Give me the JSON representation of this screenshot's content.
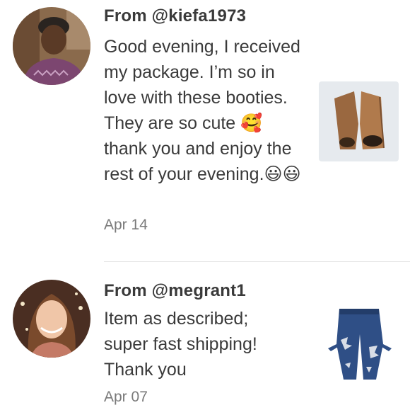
{
  "reviews": [
    {
      "author": "From @kiefa1973",
      "text": "Good evening, I received my package. I’m so in love with these booties. They are so cute 🥰 thank you and enjoy the rest of your evening.😃😃",
      "date": "Apr 14",
      "avatar_icon": "user-avatar-photo",
      "item_icon": "brown-open-toe-bootie-photo"
    },
    {
      "author": "From @megrant1",
      "text": "Item as described; super fast shipping! Thank you",
      "date": "Apr 07",
      "avatar_icon": "user-avatar-photo",
      "item_icon": "distressed-jeans-photo"
    }
  ]
}
